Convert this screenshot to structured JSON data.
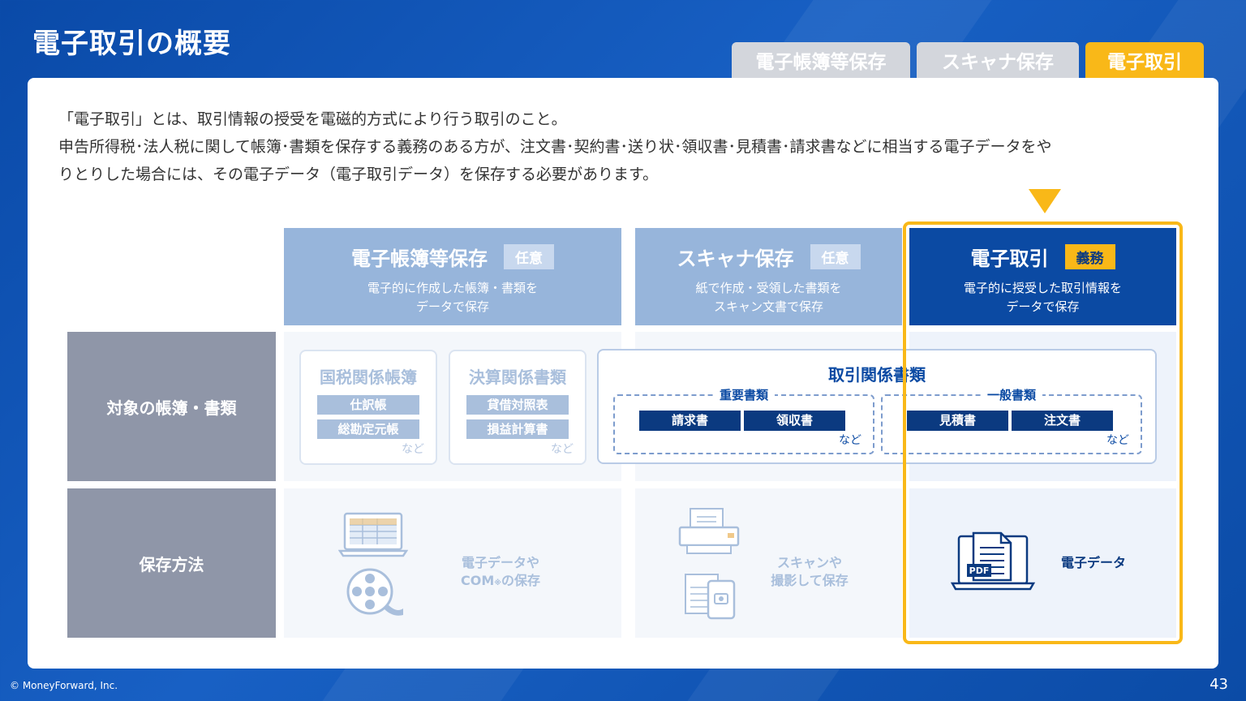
{
  "page_title": "電子取引の概要",
  "tabs": [
    {
      "label": "電子帳簿等保存"
    },
    {
      "label": "スキャナ保存"
    },
    {
      "label": "電子取引"
    }
  ],
  "intro": {
    "line1": "「電子取引」とは、取引情報の授受を電磁的方式により行う取引のこと。",
    "line2": "申告所得税･法人税に関して帳簿･書類を保存する義務のある方が、注文書･契約書･送り状･領収書･見積書･請求書などに相当する電子データをや",
    "line3": "りとりした場合には、その電子データ（電子取引データ）を保存する必要があります。"
  },
  "columns": [
    {
      "title": "電子帳簿等保存",
      "badge": "任意",
      "sub1": "電子的に作成した帳簿・書類を",
      "sub2": "データで保存"
    },
    {
      "title": "スキャナ保存",
      "badge": "任意",
      "sub1": "紙で作成・受領した書類を",
      "sub2": "スキャン文書で保存"
    },
    {
      "title": "電子取引",
      "badge": "義務",
      "sub1": "電子的に授受した取引情報を",
      "sub2": "データで保存"
    }
  ],
  "rows": {
    "target_label": "対象の帳簿・書類",
    "method_label": "保存方法"
  },
  "doc_boxes": [
    {
      "title": "国税関係帳簿",
      "items": [
        "仕訳帳",
        "総勘定元帳"
      ],
      "etc": "など"
    },
    {
      "title": "決算関係書類",
      "items": [
        "貸借対照表",
        "損益計算書"
      ],
      "etc": "など"
    }
  ],
  "torihiki": {
    "title": "取引関係書類",
    "groups": [
      {
        "label": "重要書類",
        "items": [
          "請求書",
          "領収書"
        ],
        "etc": "など"
      },
      {
        "label": "一般書類",
        "items": [
          "見積書",
          "注文書"
        ],
        "etc": "など"
      }
    ]
  },
  "methods": [
    {
      "line1": "電子データや",
      "line2a": "COM",
      "mark": "※",
      "line2b": "の保存"
    },
    {
      "line1": "スキャンや",
      "line2": "撮影して保存"
    },
    {
      "line1": "電子データ",
      "pdf": "PDF"
    }
  ],
  "footer": {
    "copyright": "© MoneyForward, Inc.",
    "page_number": "43"
  },
  "colors": {
    "brand_blue": "#0b4aa3",
    "accent_yellow": "#f9b818",
    "muted_blue": "#97b5db",
    "row_label_gray": "#8f96a8"
  },
  "icons": [
    "laptop-spreadsheet-icon",
    "film-reel-icon",
    "scanner-icon",
    "phone-camera-icon",
    "laptop-pdf-icon"
  ]
}
